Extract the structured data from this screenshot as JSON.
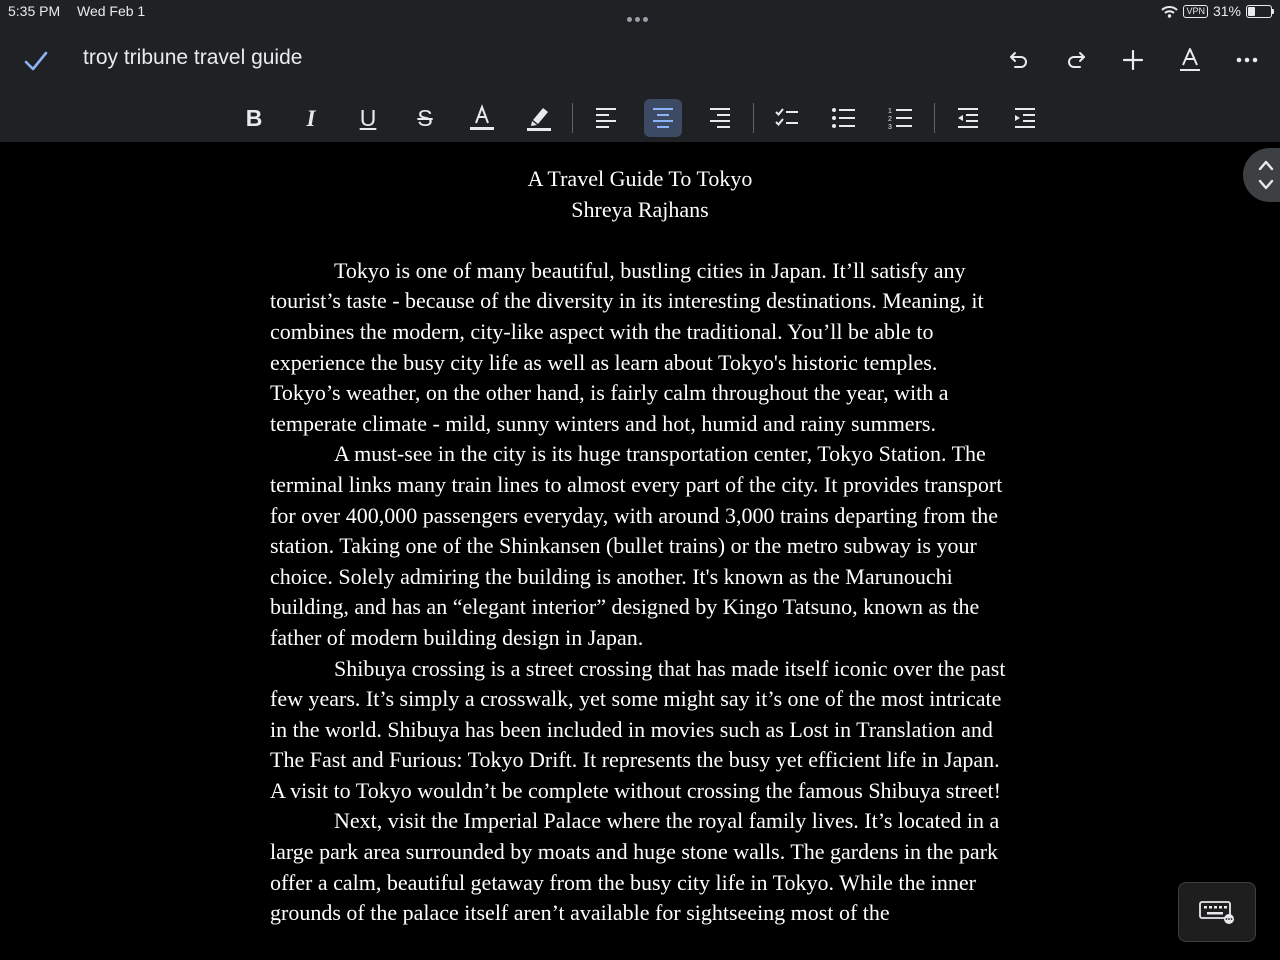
{
  "status_bar": {
    "time": "5:35 PM",
    "date": "Wed Feb 1",
    "vpn": "VPN",
    "battery": "31%",
    "battery_fraction": 0.31
  },
  "title_bar": {
    "title": "troy tribune travel guide",
    "icons": [
      "check-icon",
      "undo-icon",
      "redo-icon",
      "plus-icon",
      "text-format-icon",
      "more-icon"
    ]
  },
  "toolbar": {
    "buttons": [
      "bold-icon",
      "italic-icon",
      "underline-icon",
      "strikethrough-icon",
      "text-color-icon",
      "highlight-icon",
      "align-left-icon",
      "align-center-icon",
      "align-right-icon",
      "checklist-icon",
      "bulleted-list-icon",
      "numbered-list-icon",
      "decrease-indent-icon",
      "increase-indent-icon"
    ],
    "active": "align-center-icon",
    "colors": {
      "bar": "#202124",
      "active": "#3c4a64",
      "accent": "#8ab4f8"
    }
  },
  "document": {
    "title": "A Travel Guide To Tokyo",
    "author": "Shreya Rajhans",
    "paragraphs": [
      "Tokyo is one of many beautiful, bustling cities in Japan. It’ll satisfy any tourist’s taste - because of the diversity in its interesting destinations. Meaning, it combines the modern, city-like aspect with the traditional. You’ll be able to experience the busy city life as well as learn about Tokyo's historic temples. Tokyo’s weather, on the other hand, is fairly calm throughout the year, with a temperate climate - mild, sunny winters and hot, humid and rainy summers.",
      "A must-see in the city is its huge transportation center, Tokyo Station. The terminal links many train lines to almost every part of the city. It provides transport for over 400,000 passengers everyday, with around 3,000 trains departing from the station. Taking one of the Shinkansen (bullet trains) or the metro subway is your choice. Solely admiring the building is another. It's known as the Marunouchi building, and has an “elegant interior” designed by Kingo Tatsuno, known as the father of modern building design in Japan.",
      "Shibuya crossing is a street crossing that has made itself iconic over the past few years. It’s simply a crosswalk, yet some might say it’s one of the most intricate in the world. Shibuya has been included in movies such as Lost in Translation and The Fast and Furious: Tokyo Drift. It represents the busy yet efficient life in Japan. A visit to Tokyo wouldn’t be complete without crossing the famous Shibuya street!",
      "Next, visit the Imperial Palace where the royal family lives. It’s located in a large park area surrounded by moats and huge stone walls. The gardens in the park offer a calm, beautiful getaway from the busy city life in Tokyo. While the inner grounds of the palace itself aren’t available for sightseeing most of the"
    ]
  }
}
